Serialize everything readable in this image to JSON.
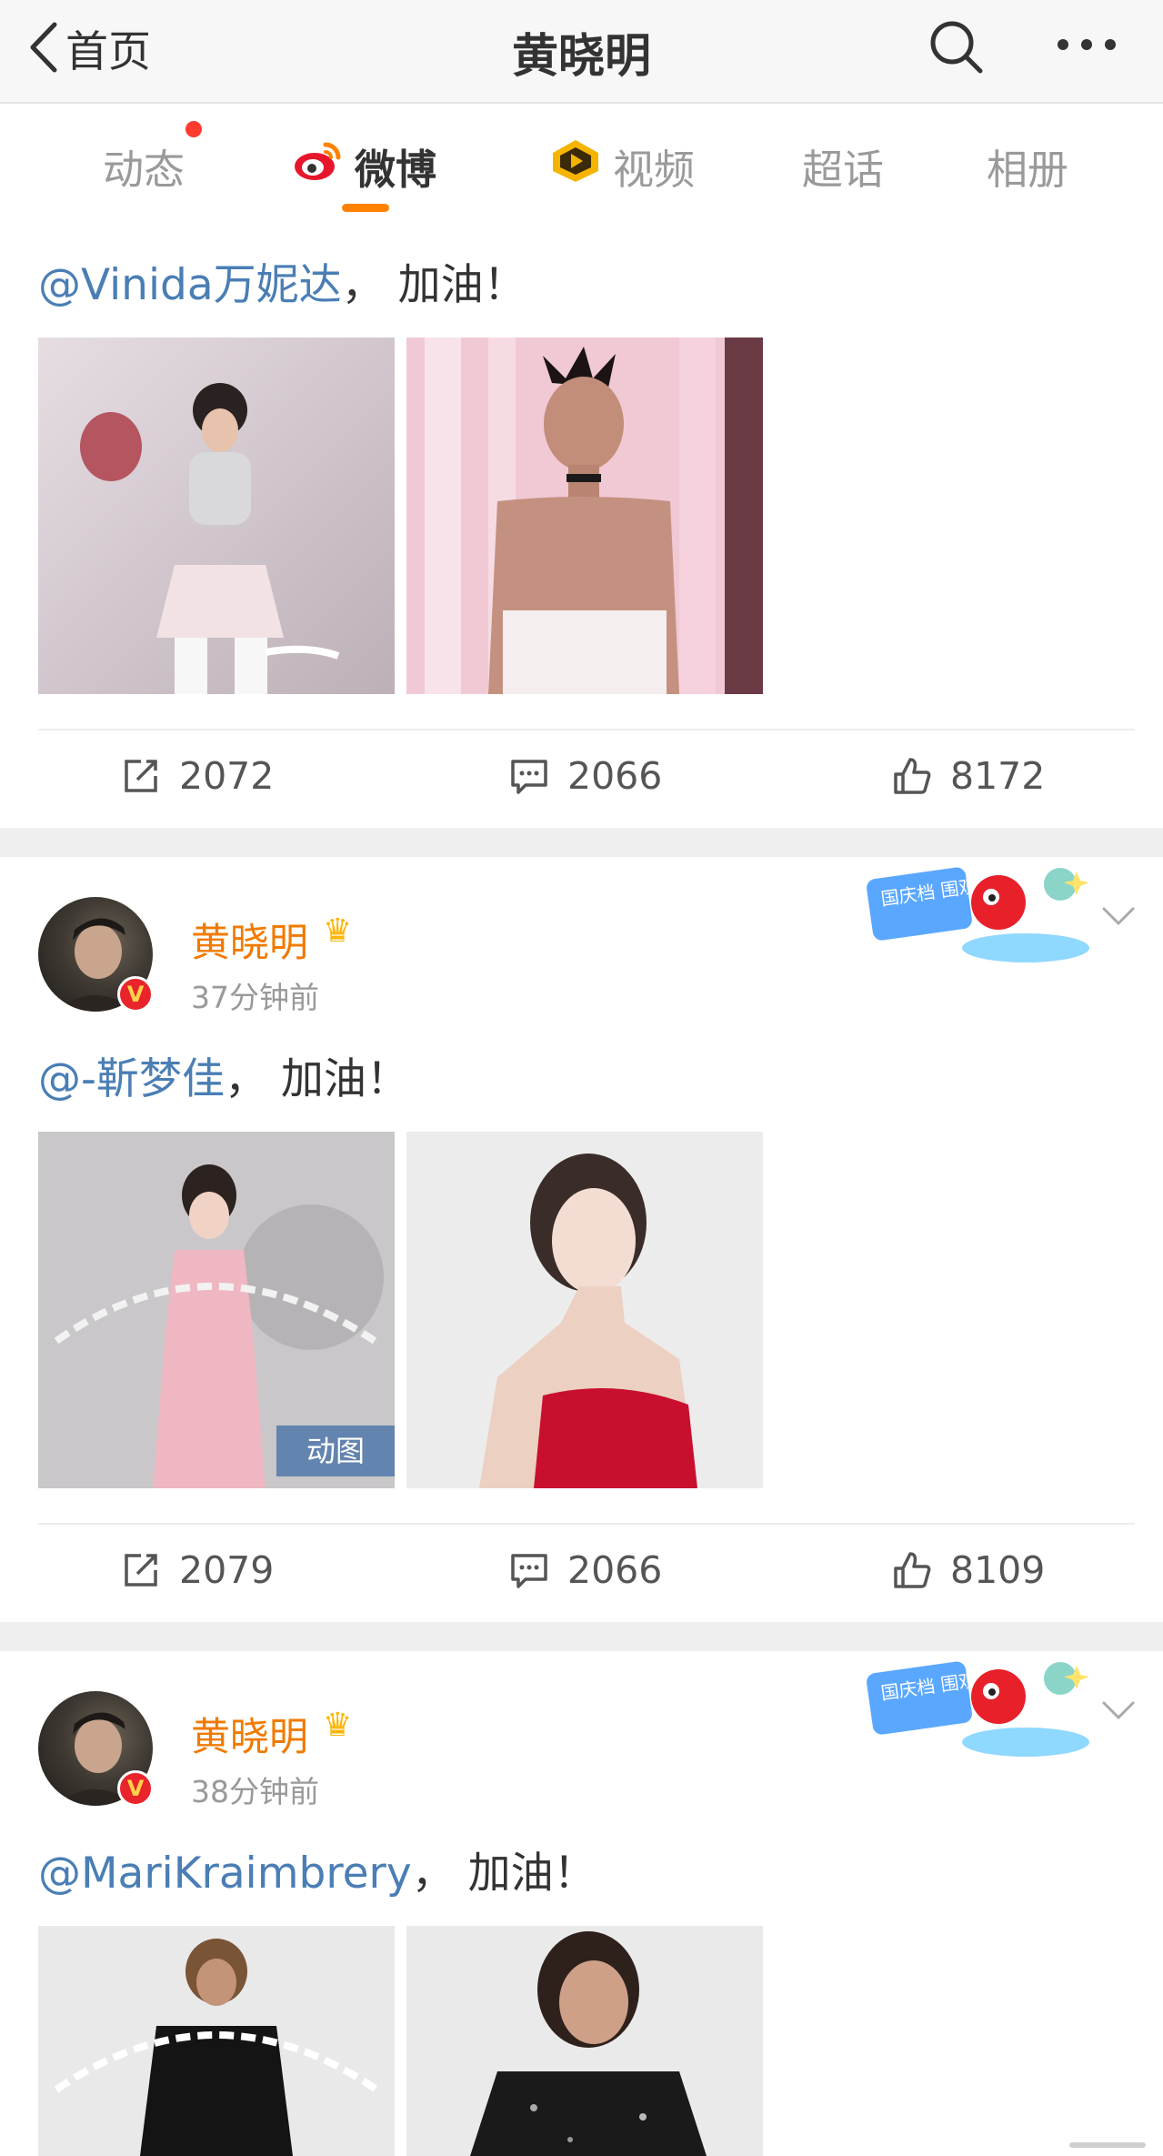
{
  "nav": {
    "back_label": "首页",
    "title": "黄晓明"
  },
  "tabs": [
    {
      "label": "动态",
      "has_red_dot": true
    },
    {
      "label": "微博",
      "active": true
    },
    {
      "label": "视频"
    },
    {
      "label": "超话"
    },
    {
      "label": "相册"
    }
  ],
  "posts": [
    {
      "mention": "@Vinida万妮达",
      "text_suffix": "，  加油！",
      "images": [
        "performer on stage with flower bouquet",
        "performer in white strapless top"
      ],
      "actions": {
        "reposts": "2072",
        "comments": "2066",
        "likes": "8172"
      }
    },
    {
      "author": "黄晓明",
      "time": "37分钟前",
      "mention": "@-靳梦佳",
      "text_suffix": "，  加油！",
      "badge": "国庆档 围观群众",
      "images": [
        "woman in pink dress",
        "woman in red strapless dress"
      ],
      "gif_tag": "动图",
      "actions": {
        "reposts": "2079",
        "comments": "2066",
        "likes": "8109"
      }
    },
    {
      "author": "黄晓明",
      "time": "38分钟前",
      "mention": "@MariKraimbrery",
      "text_suffix": "，  加油！",
      "badge": "国庆档 围观群众",
      "images": [
        "woman in black outfit",
        "woman in sequined jacket"
      ]
    }
  ],
  "colors": {
    "accent": "#ff8200",
    "mention": "#4a7eb5",
    "username": "#f07a00"
  }
}
